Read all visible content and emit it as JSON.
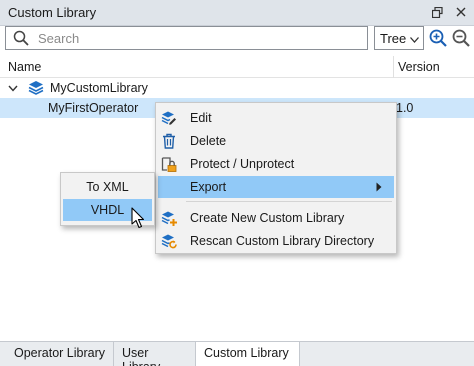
{
  "window": {
    "title": "Custom Library"
  },
  "toolbar": {
    "search_placeholder": "Search",
    "view_mode": "Tree"
  },
  "tree": {
    "columns": {
      "name": "Name",
      "version": "Version"
    },
    "rows": [
      {
        "label": "MyCustomLibrary",
        "version": ""
      },
      {
        "label": "MyFirstOperator",
        "version": "1.0"
      }
    ]
  },
  "context_menu": {
    "items": [
      {
        "label": "Edit",
        "icon": "edit-icon"
      },
      {
        "label": "Delete",
        "icon": "trash-icon"
      },
      {
        "label": "Protect / Unprotect",
        "icon": "lock-icon"
      },
      {
        "label": "Export",
        "icon": "",
        "highlighted": true,
        "has_submenu": true
      },
      {
        "label": "Create New Custom Library",
        "icon": "new-library-icon"
      },
      {
        "label": "Rescan Custom Library Directory",
        "icon": "rescan-library-icon"
      }
    ]
  },
  "export_submenu": {
    "items": [
      {
        "label": "To XML",
        "highlighted": false
      },
      {
        "label": "VHDL",
        "highlighted": true
      }
    ]
  },
  "bottom_tabs": [
    {
      "label": "Operator Library",
      "active": false
    },
    {
      "label": "User Library",
      "active": false
    },
    {
      "label": "Custom Library",
      "active": true
    }
  ],
  "colors": {
    "highlight": "#91c9f7",
    "selection": "#cde6fb",
    "accent": "#1a5fb4"
  }
}
